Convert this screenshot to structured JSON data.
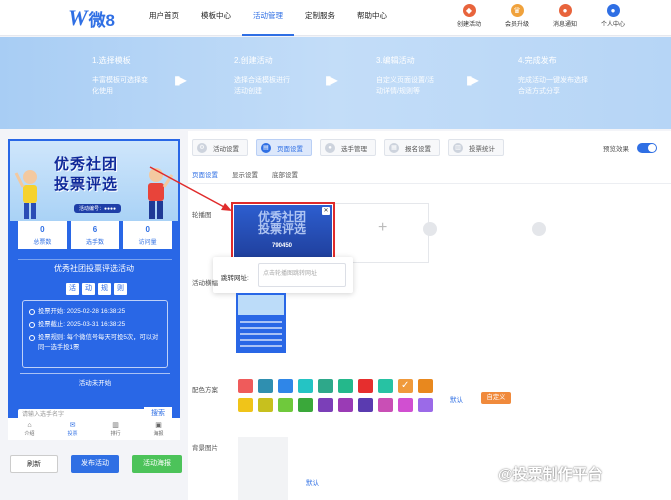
{
  "logo": {
    "mark": "W",
    "text": "微8"
  },
  "nav": {
    "items": [
      "用户首页",
      "模板中心",
      "活动管理",
      "定制服务",
      "帮助中心"
    ],
    "active": 2
  },
  "top_actions": [
    {
      "label": "创建活动",
      "icon": "pin-icon",
      "color": "#e8643c"
    },
    {
      "label": "会员升级",
      "icon": "crown-icon",
      "color": "#f0a23c"
    },
    {
      "label": "消息通知",
      "icon": "bell-icon",
      "color": "#e8643c"
    },
    {
      "label": "个人中心",
      "icon": "user-icon",
      "color": "#2f6fe4"
    }
  ],
  "steps": [
    {
      "title": "1.选择模板",
      "desc": "丰富模板可选择变化使用"
    },
    {
      "title": "2.创建活动",
      "desc": "选择合适模板进行活动创建"
    },
    {
      "title": "3.编辑活动",
      "desc": "自定义页面设置/活动详情/规则等"
    },
    {
      "title": "4.完成发布",
      "desc": "完成活动一键发布选择合适方式分享"
    }
  ],
  "preview": {
    "poster_line1": "优秀社团",
    "poster_line2": "投票评选",
    "poster_tag": "活动编号：●●●●",
    "stats": [
      {
        "value": "0",
        "label": "总票数"
      },
      {
        "value": "6",
        "label": "选手数"
      },
      {
        "value": "0",
        "label": "访问量"
      }
    ],
    "activity_title": "优秀社团投票评选活动",
    "rules_heading": [
      "活",
      "动",
      "规",
      "则"
    ],
    "rules": [
      {
        "key": "投票开始:",
        "value": "2025-02-28 16:38:25"
      },
      {
        "key": "投票截止:",
        "value": "2025-03-31 16:38:25"
      },
      {
        "key": "投票规则:",
        "value": "每个微信号每天可投5次，可以对同一选手投1票"
      }
    ],
    "status": "活动未开始",
    "search_placeholder": "请输入选手名字",
    "search_button": "搜索",
    "tabbar": [
      {
        "label": "介绍",
        "icon": "home-icon"
      },
      {
        "label": "投票",
        "icon": "vote-icon"
      },
      {
        "label": "排行",
        "icon": "rank-icon"
      },
      {
        "label": "海报",
        "icon": "poster-icon"
      }
    ]
  },
  "bottom_buttons": {
    "refresh": "刷新",
    "publish": "发布活动",
    "poster": "活动海报"
  },
  "settings": {
    "tabs": [
      {
        "label": "活动设置",
        "icon": "gear-icon"
      },
      {
        "label": "页面设置",
        "icon": "page-icon"
      },
      {
        "label": "选手管理",
        "icon": "user-icon"
      },
      {
        "label": "报名设置",
        "icon": "form-icon"
      },
      {
        "label": "投票统计",
        "icon": "chart-icon"
      }
    ],
    "active_tab": 1,
    "preview_label": "预览效果",
    "subtabs": [
      "页面设置",
      "显示设置",
      "底部设置"
    ],
    "active_subtab": 0,
    "carousel_label": "轮播图",
    "carousel_thumb_text": "优秀社团投票评选",
    "carousel_thumb_number": "790450",
    "link_label": "跳转网址:",
    "link_placeholder": "点击轮播图跳转网址",
    "mini_label": "活动横幅",
    "color_label": "配色方案",
    "colors": [
      [
        "#ef5b5b",
        "#2f8fb0",
        "#2f86e8",
        "#24c4c4",
        "#2ea88a",
        "#24b88b",
        "#e62e2e",
        "#27c2a3",
        "#f09a3c",
        "#e8881e"
      ],
      [
        "#f0c419",
        "#c7c01e",
        "#6fc93c",
        "#3aa83a",
        "#7b3fb8",
        "#9a3bb5",
        "#5a3bb0",
        "#c94fb5",
        "#d14fd1",
        "#9b6ae8"
      ]
    ],
    "selected_color": [
      0,
      8
    ],
    "default_label": "默认",
    "custom_label": "自定义",
    "bg_label": "背景图片",
    "bg_default": "默认"
  },
  "watermark": "@投票制作平台"
}
